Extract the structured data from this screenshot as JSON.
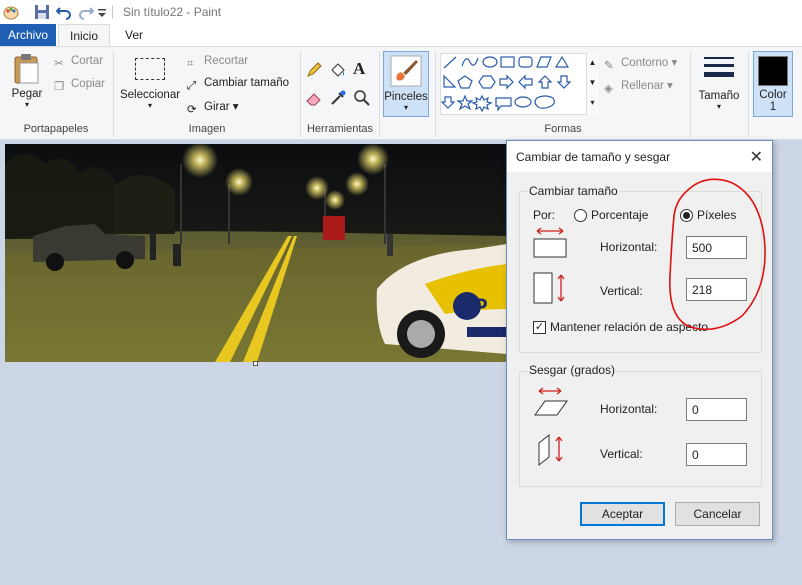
{
  "window": {
    "title": "Sin título22 - Paint"
  },
  "tabs": [
    {
      "label": "Archivo"
    },
    {
      "label": "Inicio"
    },
    {
      "label": "Ver"
    }
  ],
  "ribbon": {
    "portapapeles": {
      "paste": "Pegar",
      "cut": "Cortar",
      "copy": "Copiar",
      "label": "Portapapeles"
    },
    "imagen": {
      "select": "Seleccionar",
      "crop": "Recortar",
      "resize": "Cambiar tamaño",
      "rotate": "Girar",
      "label": "Imagen"
    },
    "herramientas": {
      "label": "Herramientas"
    },
    "pinceles": {
      "label": "Pinceles"
    },
    "formas": {
      "outline": "Contorno",
      "fill": "Rellenar",
      "label": "Formas"
    },
    "tamano": {
      "label": "Tamaño"
    },
    "color1": {
      "label": "Color",
      "number": "1"
    }
  },
  "dialog": {
    "title": "Cambiar de tamaño y sesgar",
    "resize": {
      "legend": "Cambiar tamaño",
      "by_label": "Por:",
      "percentage": "Porcentaje",
      "pixels": "Píxeles",
      "selected": "pixels",
      "horizontal_label": "Horizontal:",
      "horizontal_value": "500",
      "vertical_label": "Vertical:",
      "vertical_value": "218",
      "keep_ratio": "Mantener relación de aspecto",
      "keep_ratio_checked": true
    },
    "skew": {
      "legend": "Sesgar (grados)",
      "horizontal_label": "Horizontal:",
      "horizontal_value": "0",
      "vertical_label": "Vertical:",
      "vertical_value": "0"
    },
    "ok": "Aceptar",
    "cancel": "Cancelar"
  },
  "colors": {
    "accent": "#1e5fb4",
    "annotation": "#e01010",
    "canvas_bg": "#ccd6e6"
  }
}
